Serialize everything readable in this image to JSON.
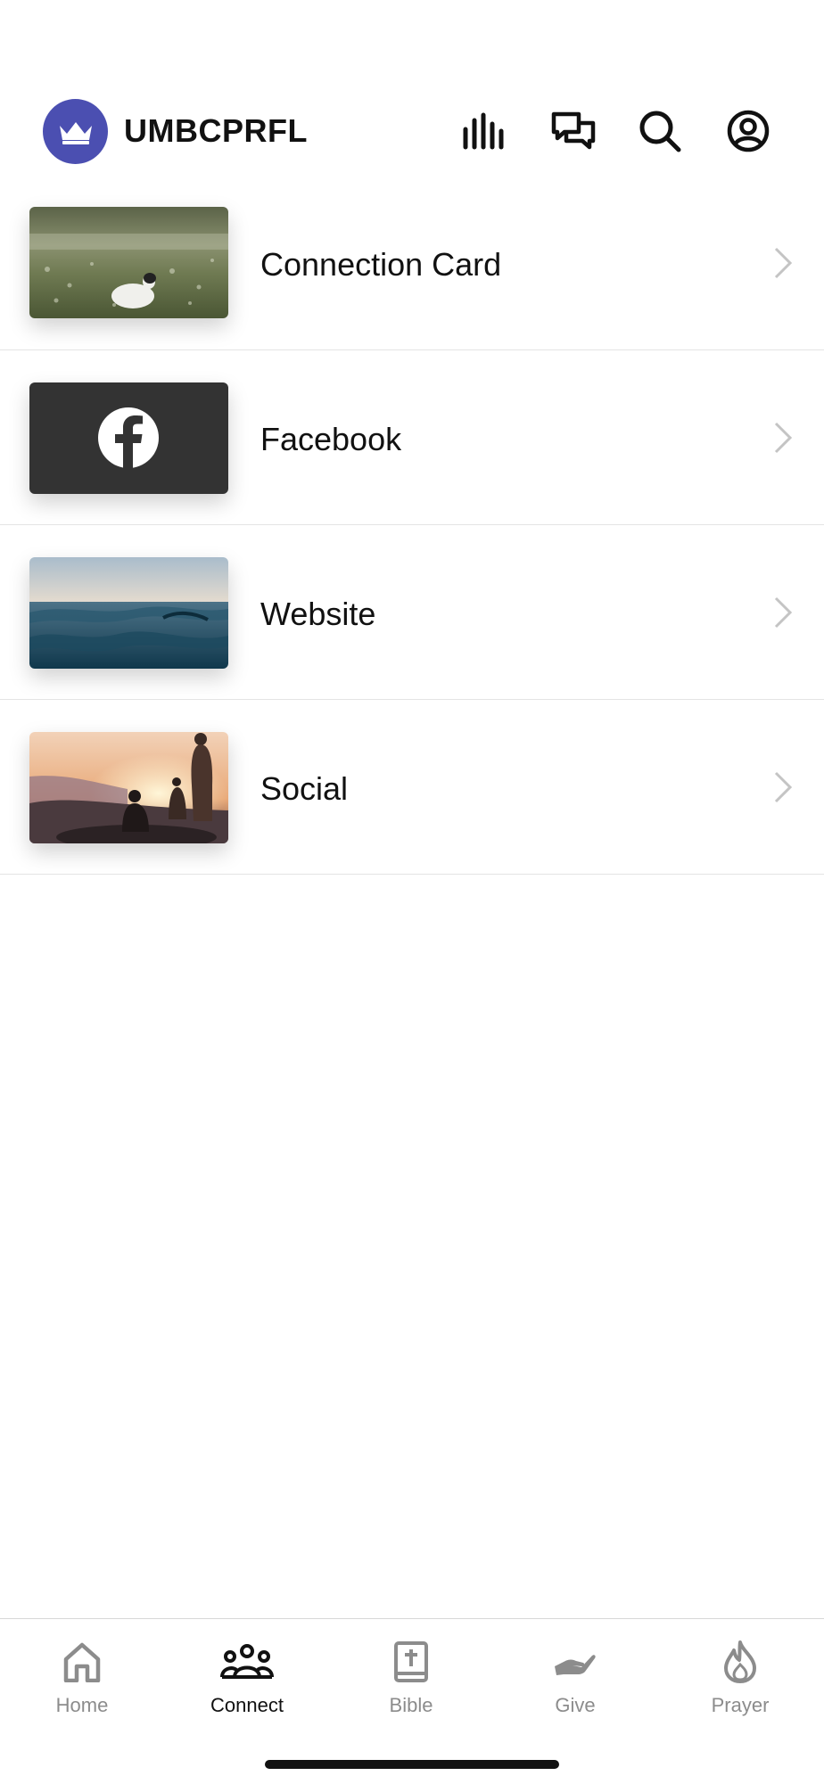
{
  "header": {
    "title": "UMBCPRFL",
    "logo_color": "#4b4fb1",
    "icons": [
      "bar-chart-icon",
      "chat-icon",
      "search-icon",
      "profile-icon"
    ]
  },
  "list": {
    "items": [
      {
        "label": "Connection Card",
        "thumbnail": "meadow-lamb"
      },
      {
        "label": "Facebook",
        "thumbnail": "facebook-logo"
      },
      {
        "label": "Website",
        "thumbnail": "ocean-waves"
      },
      {
        "label": "Social",
        "thumbnail": "sunset-people"
      }
    ]
  },
  "tabbar": {
    "active": "Connect",
    "tabs": [
      {
        "label": "Home",
        "icon": "home-icon"
      },
      {
        "label": "Connect",
        "icon": "people-icon"
      },
      {
        "label": "Bible",
        "icon": "bible-icon"
      },
      {
        "label": "Give",
        "icon": "give-hand-icon"
      },
      {
        "label": "Prayer",
        "icon": "flame-icon"
      }
    ]
  }
}
